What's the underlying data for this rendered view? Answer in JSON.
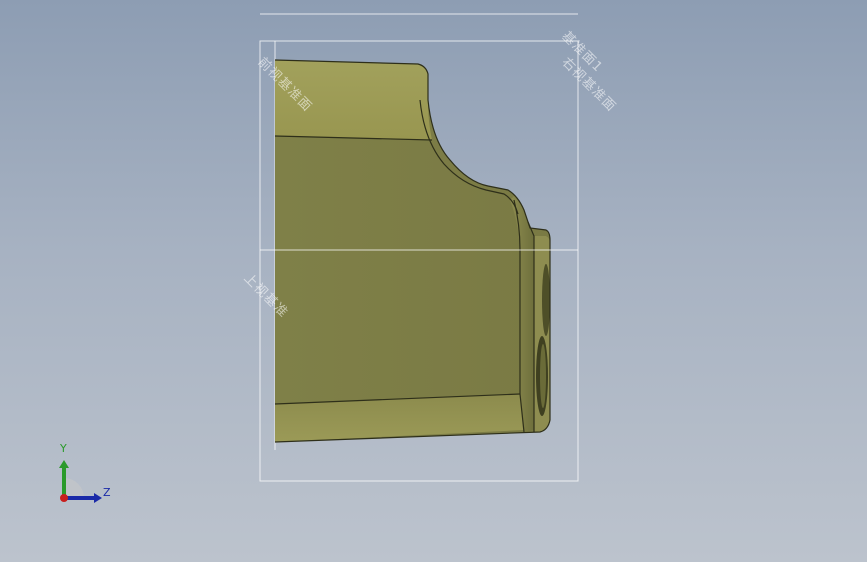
{
  "viewport": {
    "background_top": "#8d9db3",
    "background_bottom": "#bcc3cd"
  },
  "model": {
    "color_light": "#9b9a57",
    "color_dark": "#7a7b45",
    "edge_color": "#2e2f1a"
  },
  "planes": {
    "front_label": "前视基准面",
    "right_label_1": "基准面1",
    "right_label_2": "右视基准面",
    "top_label": "上视基准"
  },
  "triad": {
    "y_label": "Y",
    "z_label": "Z",
    "y_color": "#2a9a2a",
    "z_color": "#1a2aa8",
    "origin_color": "#c81e1e",
    "icons": [
      "y-axis-arrow-icon",
      "z-axis-arrow-icon",
      "origin-dot-icon"
    ]
  }
}
